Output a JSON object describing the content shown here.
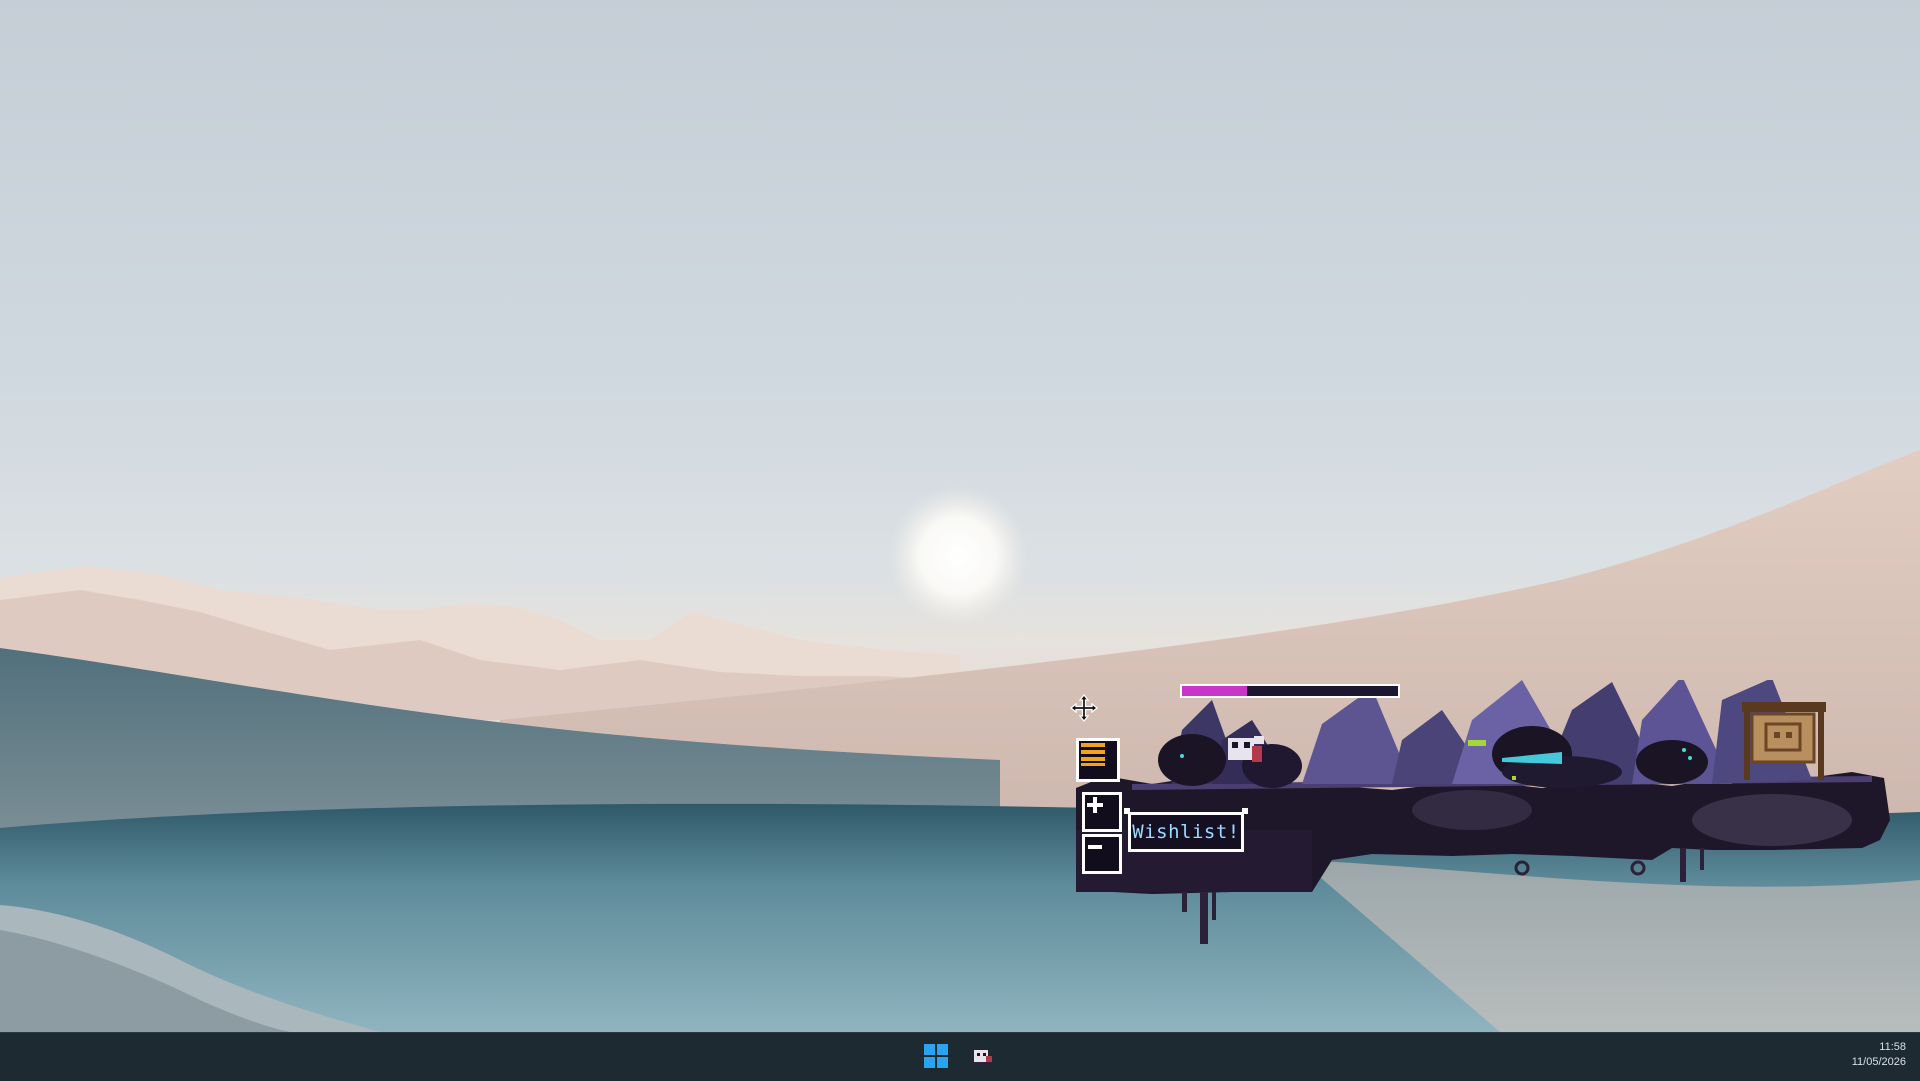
{
  "colors": {
    "taskbar": "#1d2a32",
    "start_icon": "#2aa3f0",
    "health_fill": "#c935c9",
    "wishlist_text": "#9fd9ff",
    "widget_dark": "#120d1c"
  },
  "game": {
    "health_fraction": 0.3,
    "buttons": {
      "menu_icon": "menu-lines-icon",
      "plus_icon": "plus-icon",
      "minus_icon": "minus-icon"
    },
    "wishlist_label": "Wishlist!"
  },
  "taskbar": {
    "start_icon": "windows-logo-icon",
    "pinned_app_icon": "game-app-icon",
    "clock": {
      "time": "11:58",
      "date": "11/05/2026"
    }
  }
}
